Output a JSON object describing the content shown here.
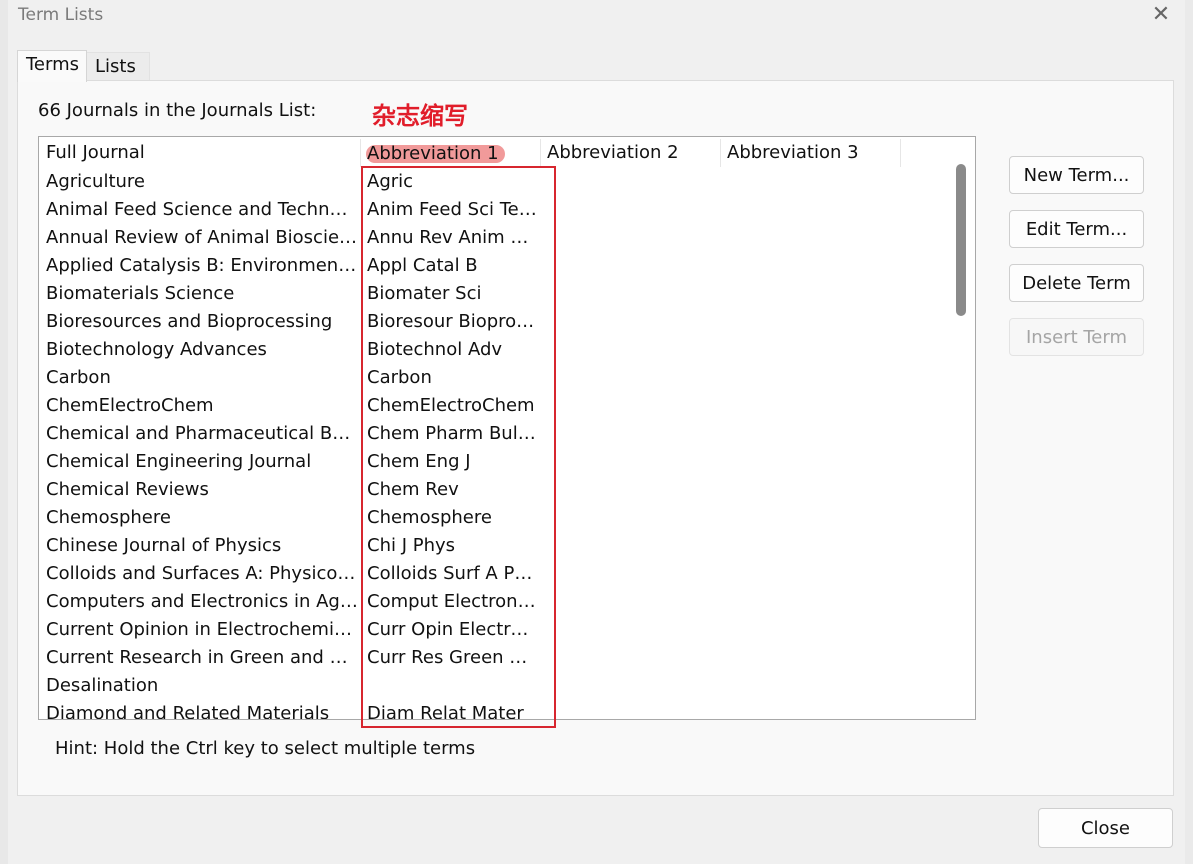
{
  "window": {
    "title": "Term Lists",
    "close_glyph": "✕"
  },
  "tabs": [
    {
      "label": "Terms",
      "active": true
    },
    {
      "label": "Lists",
      "active": false
    }
  ],
  "list_caption": "66 Journals in the Journals List:",
  "annotation": {
    "text": "杂志缩写",
    "color": "#e11d2a"
  },
  "columns": [
    "Full Journal",
    "Abbreviation 1",
    "Abbreviation 2",
    "Abbreviation 3"
  ],
  "rows": [
    {
      "full": "Agriculture",
      "abbr1": "Agric"
    },
    {
      "full": "Animal Feed Science and Technolo...",
      "abbr1": "Anim Feed Sci Tec..."
    },
    {
      "full": "Annual Review of Animal Bioscienc...",
      "abbr1": "Annu Rev Anim Bi..."
    },
    {
      "full": "Applied Catalysis B: Environmental",
      "abbr1": "Appl Catal B"
    },
    {
      "full": "Biomaterials Science",
      "abbr1": "Biomater Sci"
    },
    {
      "full": "Bioresources and Bioprocessing",
      "abbr1": "Bioresour Bioproc..."
    },
    {
      "full": "Biotechnology Advances",
      "abbr1": "Biotechnol Adv"
    },
    {
      "full": "Carbon",
      "abbr1": "Carbon"
    },
    {
      "full": "ChemElectroChem",
      "abbr1": "ChemElectroChem"
    },
    {
      "full": "Chemical and Pharmaceutical Bulle...",
      "abbr1": "Chem Pharm Bull ..."
    },
    {
      "full": "Chemical Engineering Journal",
      "abbr1": "Chem Eng J"
    },
    {
      "full": "Chemical Reviews",
      "abbr1": "Chem Rev"
    },
    {
      "full": "Chemosphere",
      "abbr1": "Chemosphere"
    },
    {
      "full": "Chinese Journal of Physics",
      "abbr1": "Chi J Phys"
    },
    {
      "full": "Colloids and Surfaces A: Physicoch...",
      "abbr1": "Colloids Surf A Ph..."
    },
    {
      "full": "Computers and Electronics in Agri...",
      "abbr1": "Comput Electron ..."
    },
    {
      "full": "Current Opinion in Electrochemistry",
      "abbr1": "Curr Opin Electro..."
    },
    {
      "full": "Current Research in Green and Sus...",
      "abbr1": "Curr Res Green Su..."
    },
    {
      "full": "Desalination",
      "abbr1": ""
    },
    {
      "full": "Diamond and Related Materials",
      "abbr1": "Diam Relat Mater"
    }
  ],
  "buttons": {
    "new_term": "New Term...",
    "edit_term": "Edit Term...",
    "delete_term": "Delete Term",
    "insert_term": "Insert Term",
    "close": "Close"
  },
  "hint": "Hint: Hold the Ctrl key to select multiple terms"
}
